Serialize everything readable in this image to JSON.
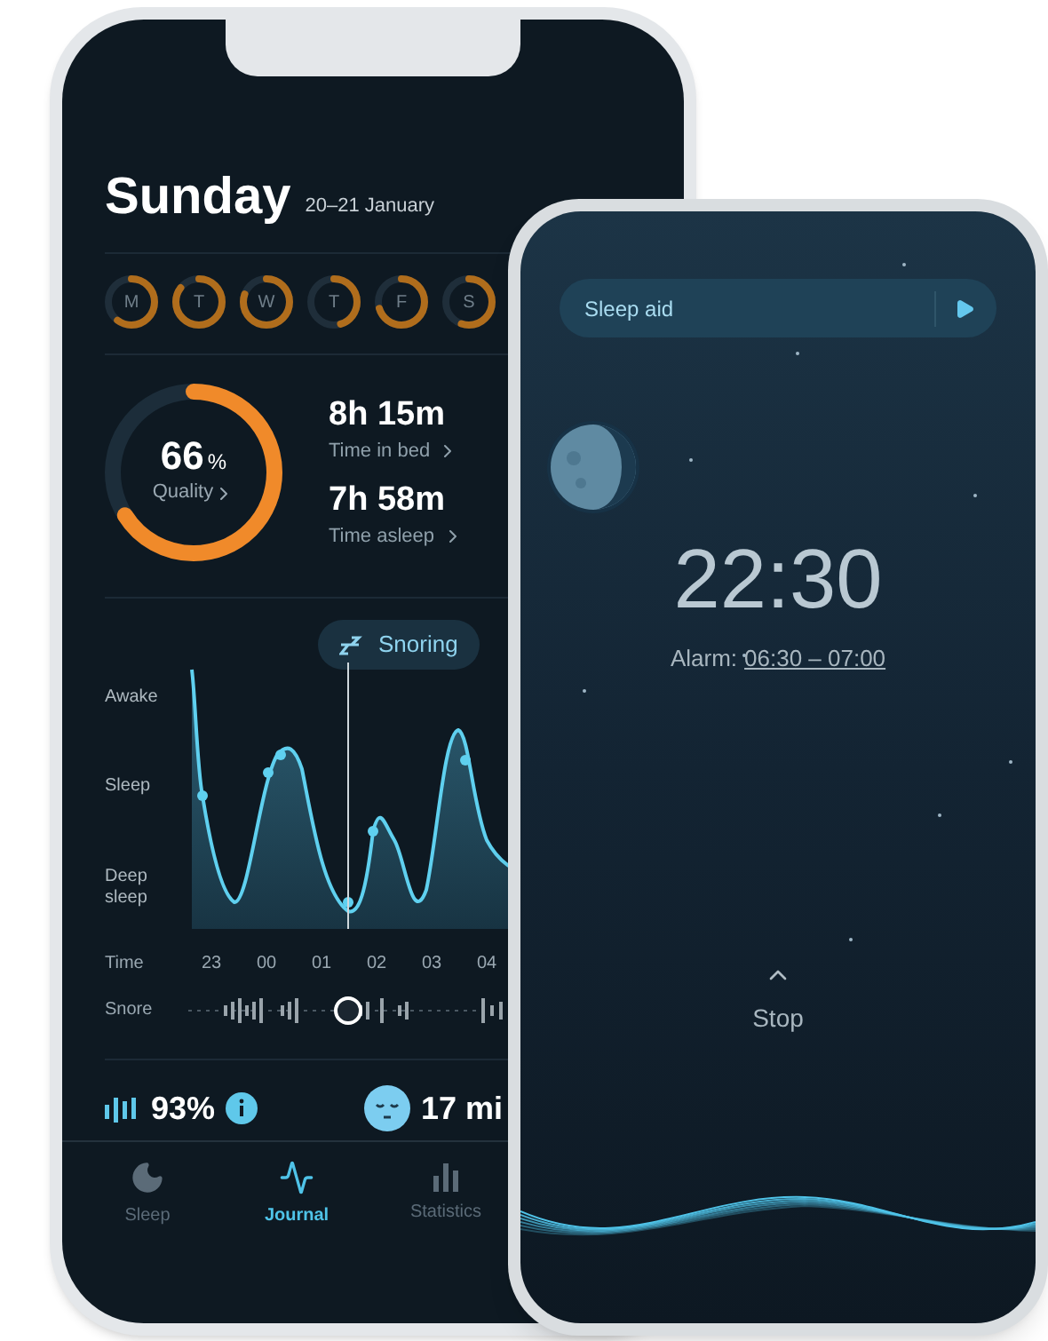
{
  "journal_screen": {
    "title": "Sunday",
    "date": "20–21 January",
    "days": [
      {
        "label": "M",
        "level": 0.6
      },
      {
        "label": "T",
        "level": 0.85
      },
      {
        "label": "W",
        "level": 0.8
      },
      {
        "label": "T",
        "level": 0.45
      },
      {
        "label": "F",
        "level": 0.7
      },
      {
        "label": "S",
        "level": 0.55
      }
    ],
    "quality": {
      "value": "66",
      "unit": "%",
      "label": "Quality",
      "level": 0.66
    },
    "stats": [
      {
        "value": "8h 15m",
        "label": "Time in bed"
      },
      {
        "value": "7h 58m",
        "label": "Time asleep"
      }
    ],
    "snoring_button": "Snoring",
    "graph": {
      "y_labels": [
        "Awake",
        "Sleep",
        "Deep sleep"
      ],
      "time_label": "Time",
      "hours": [
        "23",
        "00",
        "01",
        "02",
        "03",
        "04"
      ],
      "snore_label": "Snore"
    },
    "summary": [
      {
        "kind": "regularity",
        "value": "93%"
      },
      {
        "kind": "asleep",
        "value": "17 mi"
      }
    ],
    "tabs": [
      {
        "label": "Sleep",
        "selected": false
      },
      {
        "label": "Journal",
        "selected": true
      },
      {
        "label": "Statistics",
        "selected": false
      }
    ]
  },
  "alarm_screen": {
    "sleep_aid": "Sleep aid",
    "time": "22:30",
    "alarm_label": "Alarm:",
    "alarm_range": "06:30 – 07:00",
    "stop": "Stop"
  }
}
